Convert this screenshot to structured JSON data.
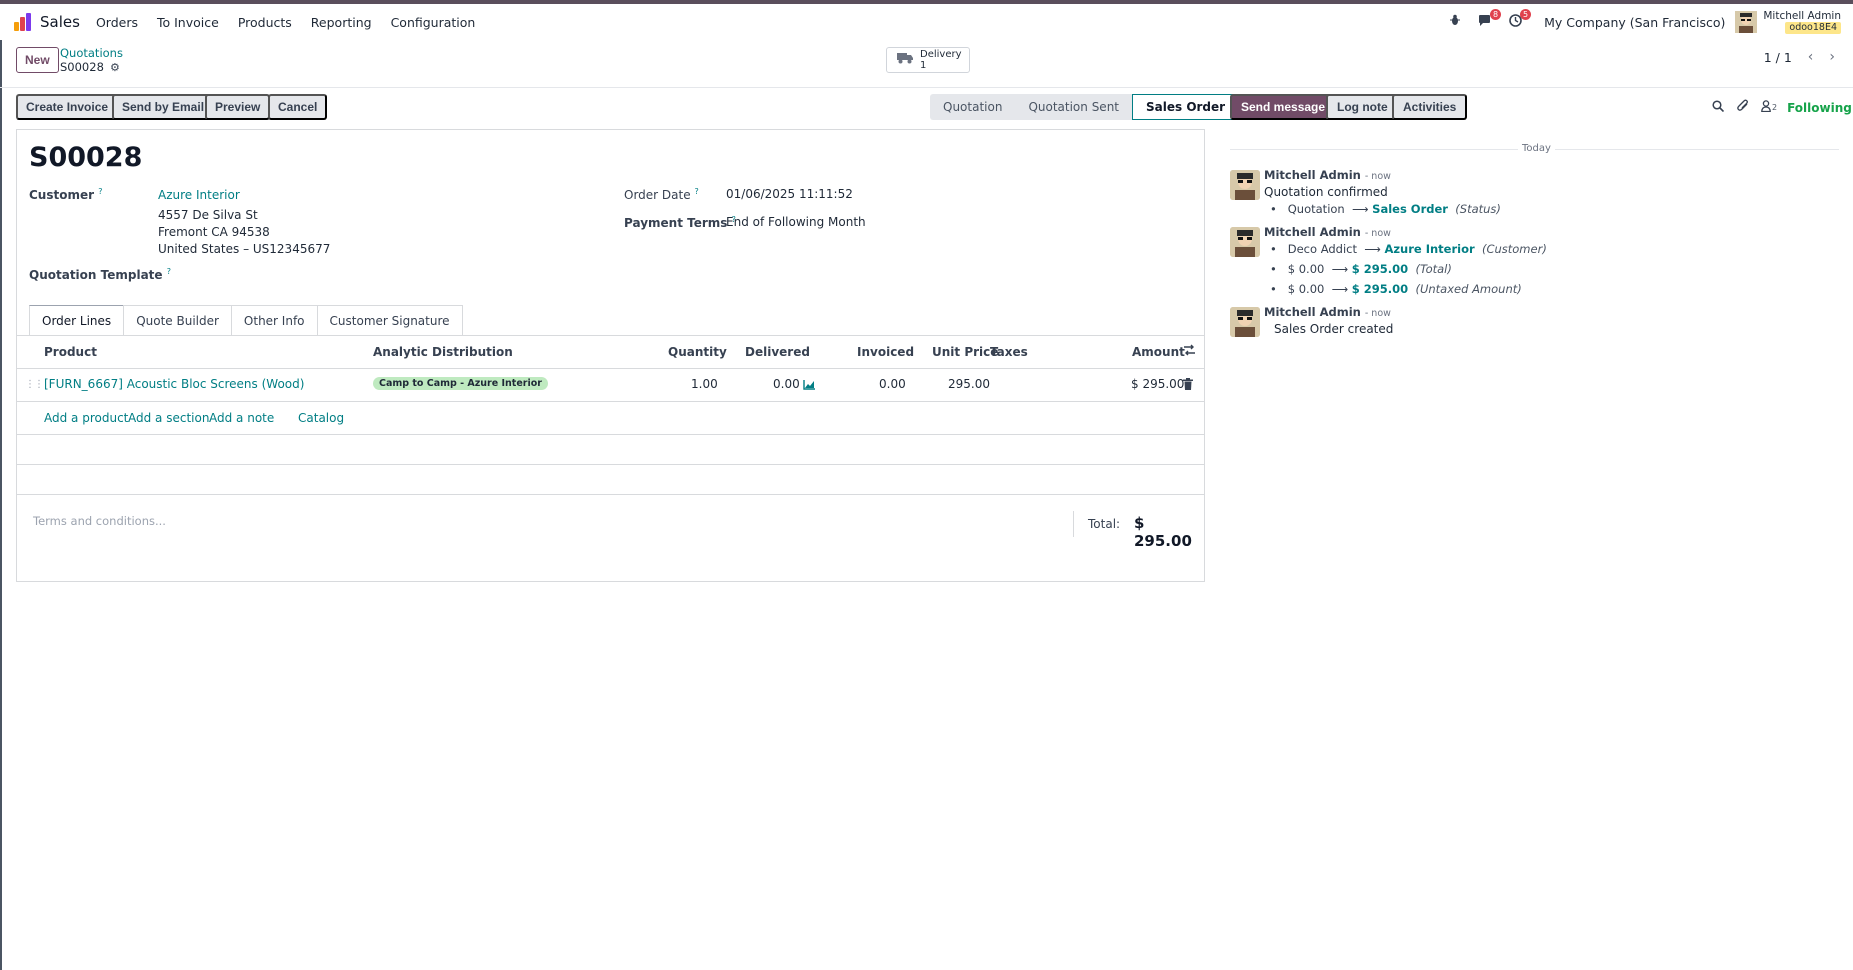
{
  "navbar": {
    "app_name": "Sales",
    "menu": [
      "Orders",
      "To Invoice",
      "Products",
      "Reporting",
      "Configuration"
    ],
    "messages_count": "8",
    "activities_count": "5",
    "company": "My Company (San Francisco)",
    "user_name": "Mitchell Admin",
    "database": "odoo18E4"
  },
  "control": {
    "new_label": "New",
    "breadcrumb_parent": "Quotations",
    "breadcrumb_current": "S00028",
    "delivery_label": "Delivery",
    "delivery_count": "1",
    "pager": "1 / 1"
  },
  "actions": {
    "create_invoice": "Create Invoice",
    "send_email": "Send by Email",
    "preview": "Preview",
    "cancel": "Cancel"
  },
  "status": {
    "stages": [
      "Quotation",
      "Quotation Sent",
      "Sales Order"
    ],
    "active": "Sales Order"
  },
  "form": {
    "title": "S00028",
    "customer_label": "Customer",
    "customer": "Azure Interior",
    "address_line1": "4557 De Silva St",
    "address_line2": "Fremont CA 94538",
    "address_line3": "United States – US12345677",
    "order_date_label": "Order Date",
    "order_date": "01/06/2025 11:11:52",
    "payment_terms_label": "Payment Terms",
    "payment_terms": "End of Following Month",
    "template_label": "Quotation Template",
    "tabs": [
      "Order Lines",
      "Quote Builder",
      "Other Info",
      "Customer Signature"
    ]
  },
  "order_lines": {
    "headers": {
      "product": "Product",
      "analytic": "Analytic Distribution",
      "quantity": "Quantity",
      "delivered": "Delivered",
      "invoiced": "Invoiced",
      "unit_price": "Unit Price",
      "taxes": "Taxes",
      "amount": "Amount"
    },
    "rows": [
      {
        "product": "[FURN_6667] Acoustic Bloc Screens (Wood)",
        "analytic": "Camp to Camp - Azure Interior",
        "quantity": "1.00",
        "delivered": "0.00",
        "invoiced": "0.00",
        "unit_price": "295.00",
        "amount": "$ 295.00"
      }
    ],
    "add_product": "Add a product",
    "add_section": "Add a section",
    "add_note": "Add a note",
    "catalog": "Catalog",
    "terms_placeholder": "Terms and conditions...",
    "total_label": "Total:",
    "total": "$ 295.00"
  },
  "chatter": {
    "send_message": "Send message",
    "log_note": "Log note",
    "activities": "Activities",
    "followers_count": "2",
    "following": "Following",
    "today": "Today",
    "messages": [
      {
        "author": "Mitchell Admin",
        "time": "- now",
        "body": "Quotation confirmed",
        "changes": [
          {
            "old": "Quotation",
            "new": "Sales Order",
            "field": "(Status)"
          }
        ]
      },
      {
        "author": "Mitchell Admin",
        "time": "- now",
        "body": "",
        "changes": [
          {
            "old": "Deco Addict",
            "new": "Azure Interior",
            "field": "(Customer)"
          },
          {
            "old": "$ 0.00",
            "new": "$ 295.00",
            "field": "(Total)"
          },
          {
            "old": "$ 0.00",
            "new": "$ 295.00",
            "field": "(Untaxed Amount)"
          }
        ]
      },
      {
        "author": "Mitchell Admin",
        "time": "- now",
        "body": "Sales Order created",
        "changes": []
      }
    ]
  },
  "colors": {
    "brand": "#714b67",
    "link": "#017e84",
    "badge": "#e0424e",
    "following": "#16a34a"
  },
  "icons": [
    "bug-icon",
    "chat-icon",
    "clock-icon",
    "truck-icon",
    "chevron-left-icon",
    "chevron-right-icon",
    "gear-icon",
    "drag-handle-icon",
    "forecast-chart-icon",
    "trash-icon",
    "optional-columns-icon",
    "search-icon",
    "paperclip-icon",
    "followers-icon"
  ]
}
